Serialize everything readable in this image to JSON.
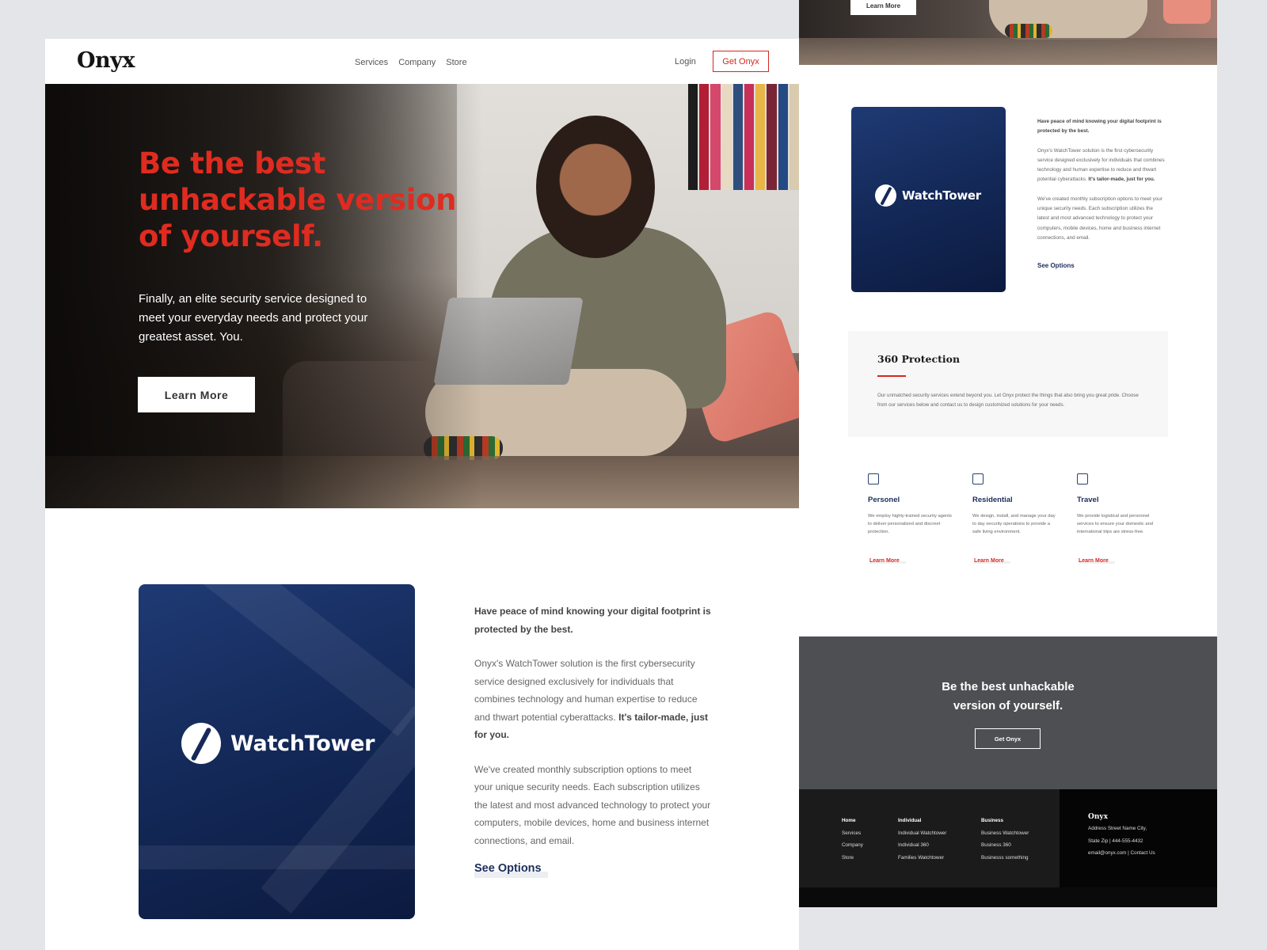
{
  "nav": {
    "logo": "Onyx",
    "links": [
      "Services",
      "Company",
      "Store"
    ],
    "login": "Login",
    "cta": "Get Onyx"
  },
  "hero": {
    "title": "Be the best unhackable version of yourself.",
    "subtitle": "Finally, an elite security service designed to meet your everyday needs and protect your greatest asset. You.",
    "button": "Learn More"
  },
  "watchtower": {
    "brand": "WatchTower",
    "lead": "Have peace of mind knowing your digital footprint is protected by the best.",
    "para1": "Onyx's WatchTower solution is the first cybersecurity service designed exclusively for individuals that combines technology and human expertise to reduce and thwart potential cyberattacks.",
    "para1_bold": "It's tailor-made, just for you.",
    "para2": "We've created monthly subscription options to meet your unique security needs. Each subscription utilizes the latest and most advanced technology to protect your computers, mobile devices, home and business internet connections, and email.",
    "link": "See Options"
  },
  "protection": {
    "title": "360 Protection",
    "text": "Our unmatched security services extend beyond you. Let Onyx protect the things that also bring you great pride. Choose from our services below and contact us to design customized solutions for your needs."
  },
  "services": [
    {
      "icon": "personnel-icon",
      "title": "Personel",
      "text": "We employ highly-trained security agents to deliver personalized and discreet protection.",
      "link": "Learn More"
    },
    {
      "icon": "home-icon",
      "title": "Residential",
      "text": "We design, install, and manage your day to day security operations to provide a safe living environment.",
      "link": "Learn More"
    },
    {
      "icon": "plane-icon",
      "title": "Travel",
      "text": "We provide logistical and personnel services to ensure your domestic and international trips are stress-free.",
      "link": "Learn More"
    }
  ],
  "cta": {
    "title": "Be the best unhackable version of yourself.",
    "button": "Get Onyx"
  },
  "footer": {
    "col1": [
      "Home",
      "Services",
      "Company",
      "Store"
    ],
    "col2": [
      "Individual",
      "Individual Watchtower",
      "Individual 360",
      "Families Watchtower"
    ],
    "col3": [
      "Business",
      "Business Watchtower",
      "Business 360",
      "Businesss something"
    ],
    "brand": "Onyx",
    "address1": "Address Street Name City,",
    "address2": "State Zip  |  444-555-4432",
    "contact": "email@onyx.com | Contact Us"
  },
  "colors": {
    "accent": "#d7261e",
    "navy": "#1b2d5c",
    "cta_bg": "#4e4f53",
    "footer_bg": "#1b1b1b"
  }
}
